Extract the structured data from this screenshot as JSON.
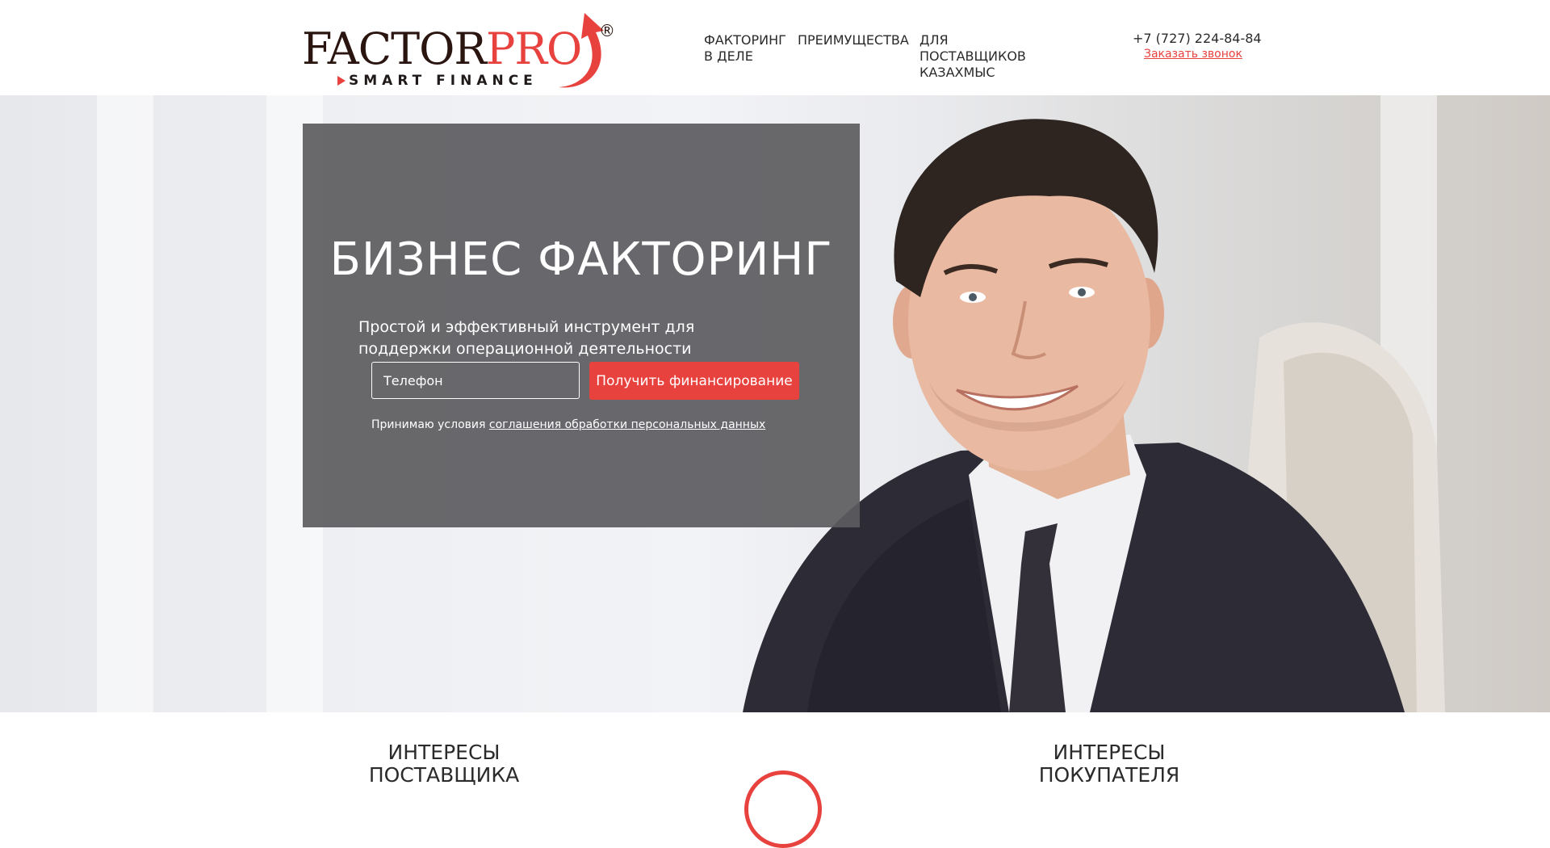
{
  "logo": {
    "word_part1": "FACTOR",
    "word_part2": "PRO",
    "registered": "®",
    "tagline": "SMART FINANCE"
  },
  "nav": {
    "item1": "ФАКТОРИНГ В ДЕЛЕ",
    "item2": "ПРЕИМУЩЕСТВА",
    "item3": "ДЛЯ ПОСТАВЩИКОВ КАЗАХМЫС"
  },
  "contact": {
    "phone": "+7 (727) 224-84-84",
    "callback_link": "Заказать звонок"
  },
  "hero": {
    "title": "БИЗНЕС ФАКТОРИНГ",
    "subtitle": "Простой и эффективный инструмент для поддержки операционной деятельности",
    "phone_placeholder": "Телефон",
    "cta_label": "Получить финансирование",
    "consent_text": "Принимаю условия",
    "consent_link": "соглашения обработки персональных данных"
  },
  "bottom": {
    "interest_left": "ИНТЕРЕСЫ ПОСТАВЩИКА",
    "interest_right": "ИНТЕРЕСЫ ПОКУПАТЕЛЯ"
  },
  "colors": {
    "accent": "#e8423f",
    "panel": "#5c5b5e",
    "text_dark": "#2b2b2b"
  }
}
